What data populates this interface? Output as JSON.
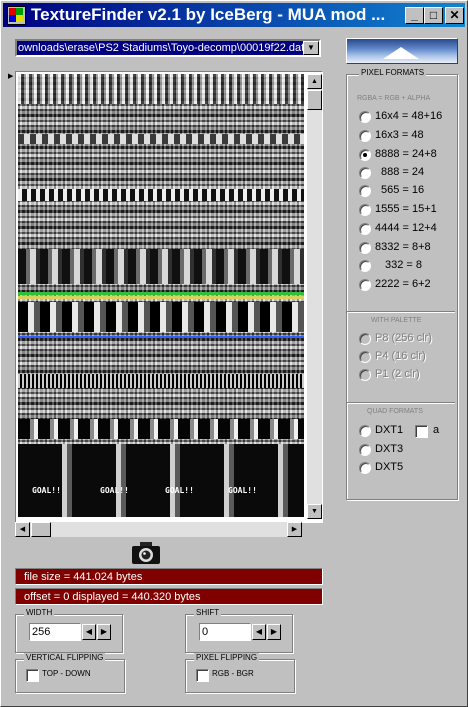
{
  "window": {
    "title": "TextureFinder v2.1 by IceBerg - MUA mod ...",
    "minimize": "_",
    "maximize": "□",
    "close": "✕"
  },
  "file": {
    "path": "ownloads\\erase\\PS2 Stadiums\\Toyo-decomp\\00019f22.dat"
  },
  "info": {
    "file_size": "file size = 441.024 bytes",
    "offset": "offset = 0   displayed = 440.320 bytes"
  },
  "pixel_formats": {
    "title": "PIXEL FORMATS",
    "subtitle": "RGBA = RGB + ALPHA",
    "options": [
      "16x4 = 48+16",
      "16x3 = 48",
      "8888 = 24+8",
      "888 = 24",
      "565 = 16",
      "1555 = 15+1",
      "4444 = 12+4",
      "8332 = 8+8",
      "332 = 8",
      "2222 = 6+2"
    ],
    "selected": "8888 = 24+8",
    "palette_title": "WITH PALETTE",
    "palette_options": [
      "P8  (256 clr)",
      "P4  (16 clr)",
      "P1   (2 clr)"
    ],
    "quad_title": "QUAD FORMATS",
    "quad_options": [
      "DXT1",
      "DXT3",
      "DXT5"
    ],
    "alpha_label": "a"
  },
  "width": {
    "label": "WIDTH",
    "value": "256"
  },
  "shift": {
    "label": "SHIFT",
    "value": "0"
  },
  "vflip": {
    "label": "VERTICAL FLIPPING",
    "option": "TOP - DOWN"
  },
  "pflip": {
    "label": "PIXEL FLIPPING",
    "option": "RGB  -  BGR"
  },
  "texture_caption": "GOAL!!",
  "icons": [
    "app-icon",
    "iceberg-logo",
    "camera-icon",
    "arrow-up-icon",
    "arrow-down-icon",
    "arrow-left-icon",
    "arrow-right-icon",
    "dropdown-arrow-icon"
  ]
}
